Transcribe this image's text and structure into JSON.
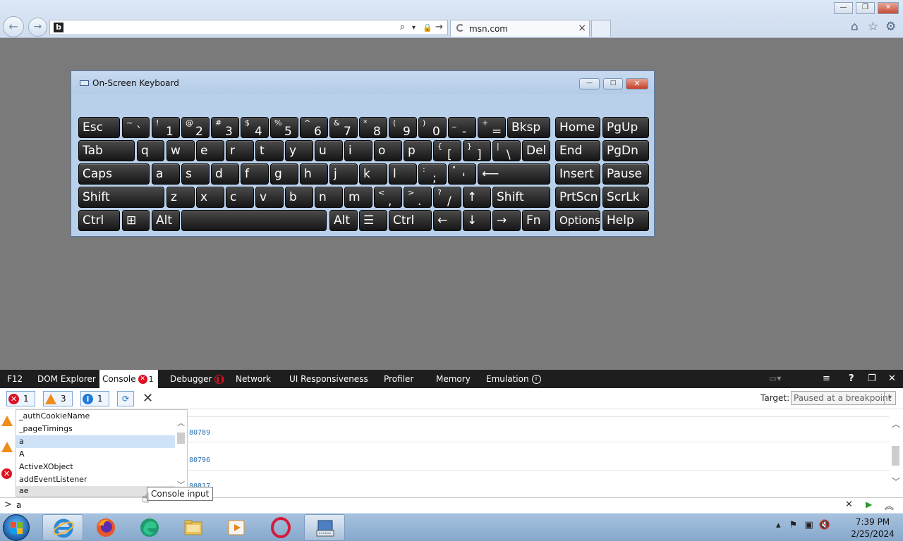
{
  "browser": {
    "back_glyph": "←",
    "forward_glyph": "→",
    "favicon_glyph": "b",
    "address_icons": {
      "search": "⌕",
      "dropdown": "▾",
      "lock": "🔒",
      "go": "→"
    },
    "tab_title": "msn.com",
    "tab_close": "×",
    "window_buttons": {
      "minimize": "—",
      "restore": "❐",
      "close": "✕"
    },
    "tools": {
      "home": "⌂",
      "favorites": "☆",
      "settings": "⚙"
    }
  },
  "osk": {
    "title": "On-Screen Keyboard",
    "buttons": {
      "minimize": "—",
      "maximize": "□",
      "close": "✕"
    },
    "keys": [
      {
        "id": "esc",
        "m": "Esc"
      },
      {
        "id": "backtick",
        "m": "` ",
        "s": "~"
      },
      {
        "id": "1",
        "m": "1",
        "s": "!"
      },
      {
        "id": "2",
        "m": "2",
        "s": "@"
      },
      {
        "id": "3",
        "m": "3",
        "s": "#"
      },
      {
        "id": "4",
        "m": "4",
        "s": "$"
      },
      {
        "id": "5",
        "m": "5",
        "s": "%"
      },
      {
        "id": "6",
        "m": "6",
        "s": "^"
      },
      {
        "id": "7",
        "m": "7",
        "s": "&"
      },
      {
        "id": "8",
        "m": "8",
        "s": "*"
      },
      {
        "id": "9",
        "m": "9",
        "s": "("
      },
      {
        "id": "0",
        "m": "0",
        "s": ")"
      },
      {
        "id": "minus",
        "m": "-",
        "s": "_"
      },
      {
        "id": "equals",
        "m": "=",
        "s": "+"
      },
      {
        "id": "bksp",
        "m": "Bksp"
      },
      {
        "id": "home",
        "m": "Home"
      },
      {
        "id": "pgup",
        "m": "PgUp"
      },
      {
        "id": "tab",
        "m": "Tab"
      },
      {
        "id": "q",
        "m": "q"
      },
      {
        "id": "w",
        "m": "w"
      },
      {
        "id": "e",
        "m": "e"
      },
      {
        "id": "r",
        "m": "r"
      },
      {
        "id": "t",
        "m": "t"
      },
      {
        "id": "y",
        "m": "y"
      },
      {
        "id": "u",
        "m": "u"
      },
      {
        "id": "i",
        "m": "i"
      },
      {
        "id": "o",
        "m": "o"
      },
      {
        "id": "p",
        "m": "p"
      },
      {
        "id": "lbracket",
        "m": "[",
        "s": "{"
      },
      {
        "id": "rbracket",
        "m": "]",
        "s": "}"
      },
      {
        "id": "backslash",
        "m": "\\",
        "s": "|"
      },
      {
        "id": "del",
        "m": "Del"
      },
      {
        "id": "end",
        "m": "End"
      },
      {
        "id": "pgdn",
        "m": "PgDn"
      },
      {
        "id": "caps",
        "m": "Caps"
      },
      {
        "id": "a",
        "m": "a"
      },
      {
        "id": "s",
        "m": "s"
      },
      {
        "id": "d",
        "m": "d"
      },
      {
        "id": "f",
        "m": "f"
      },
      {
        "id": "g",
        "m": "g"
      },
      {
        "id": "h",
        "m": "h"
      },
      {
        "id": "j",
        "m": "j"
      },
      {
        "id": "k",
        "m": "k"
      },
      {
        "id": "l",
        "m": "l"
      },
      {
        "id": "semicolon",
        "m": ";",
        "s": ":"
      },
      {
        "id": "quote",
        "m": "'",
        "s": "\""
      },
      {
        "id": "enter",
        "m": "⟵"
      },
      {
        "id": "insert",
        "m": "Insert"
      },
      {
        "id": "pause",
        "m": "Pause"
      },
      {
        "id": "lshift",
        "m": "Shift"
      },
      {
        "id": "z",
        "m": "z"
      },
      {
        "id": "x",
        "m": "x"
      },
      {
        "id": "c",
        "m": "c"
      },
      {
        "id": "v",
        "m": "v"
      },
      {
        "id": "b",
        "m": "b"
      },
      {
        "id": "n",
        "m": "n"
      },
      {
        "id": "m",
        "m": "m"
      },
      {
        "id": "comma",
        "m": ",",
        "s": "<"
      },
      {
        "id": "period",
        "m": ".",
        "s": ">"
      },
      {
        "id": "slash",
        "m": "/",
        "s": "?"
      },
      {
        "id": "up",
        "m": "↑"
      },
      {
        "id": "rshift",
        "m": "Shift"
      },
      {
        "id": "prtscn",
        "m": "PrtScn"
      },
      {
        "id": "scrlk",
        "m": "ScrLk"
      },
      {
        "id": "lctrl",
        "m": "Ctrl"
      },
      {
        "id": "win",
        "m": "⊞"
      },
      {
        "id": "lalt",
        "m": "Alt"
      },
      {
        "id": "space",
        "m": ""
      },
      {
        "id": "ralt",
        "m": "Alt"
      },
      {
        "id": "menu",
        "m": "☰"
      },
      {
        "id": "rctrl",
        "m": "Ctrl"
      },
      {
        "id": "left",
        "m": "←"
      },
      {
        "id": "down",
        "m": "↓"
      },
      {
        "id": "right",
        "m": "→"
      },
      {
        "id": "fn",
        "m": "Fn"
      },
      {
        "id": "options",
        "m": "Options"
      },
      {
        "id": "help",
        "m": "Help"
      }
    ]
  },
  "devtools": {
    "tabs": {
      "f12": "F12",
      "dom": "DOM Explorer",
      "console": "Console",
      "console_count": "1",
      "debugger": "Debugger",
      "network": "Network",
      "ui": "UI Responsiveness",
      "profiler": "Profiler",
      "memory": "Memory",
      "emulation": "Emulation"
    },
    "right_icons": {
      "console_toggle": "≡",
      "help": "?",
      "undock": "❐",
      "close": "✕"
    },
    "filters": {
      "errors": "1",
      "warnings": "3",
      "info": "1"
    },
    "clear_glyph": "✕",
    "target_label": "Target:",
    "target_value": "Paused at a breakpoint",
    "log_values": [
      "80789",
      "80796",
      "80817"
    ],
    "autocomplete": [
      "_authCookieName",
      "_pageTimings",
      "a",
      "A",
      "ActiveXObject",
      "addEventListener",
      "ae"
    ],
    "input_prompt": ">",
    "input_value": "a",
    "tooltip": "Console input"
  },
  "taskbar": {
    "clock_time": "7:39 PM",
    "clock_date": "2/25/2024"
  },
  "colors": {
    "accent": "#1f7bd8",
    "error": "#dd1122",
    "warning": "#f08c1a",
    "console_number": "#2a6fb0"
  }
}
